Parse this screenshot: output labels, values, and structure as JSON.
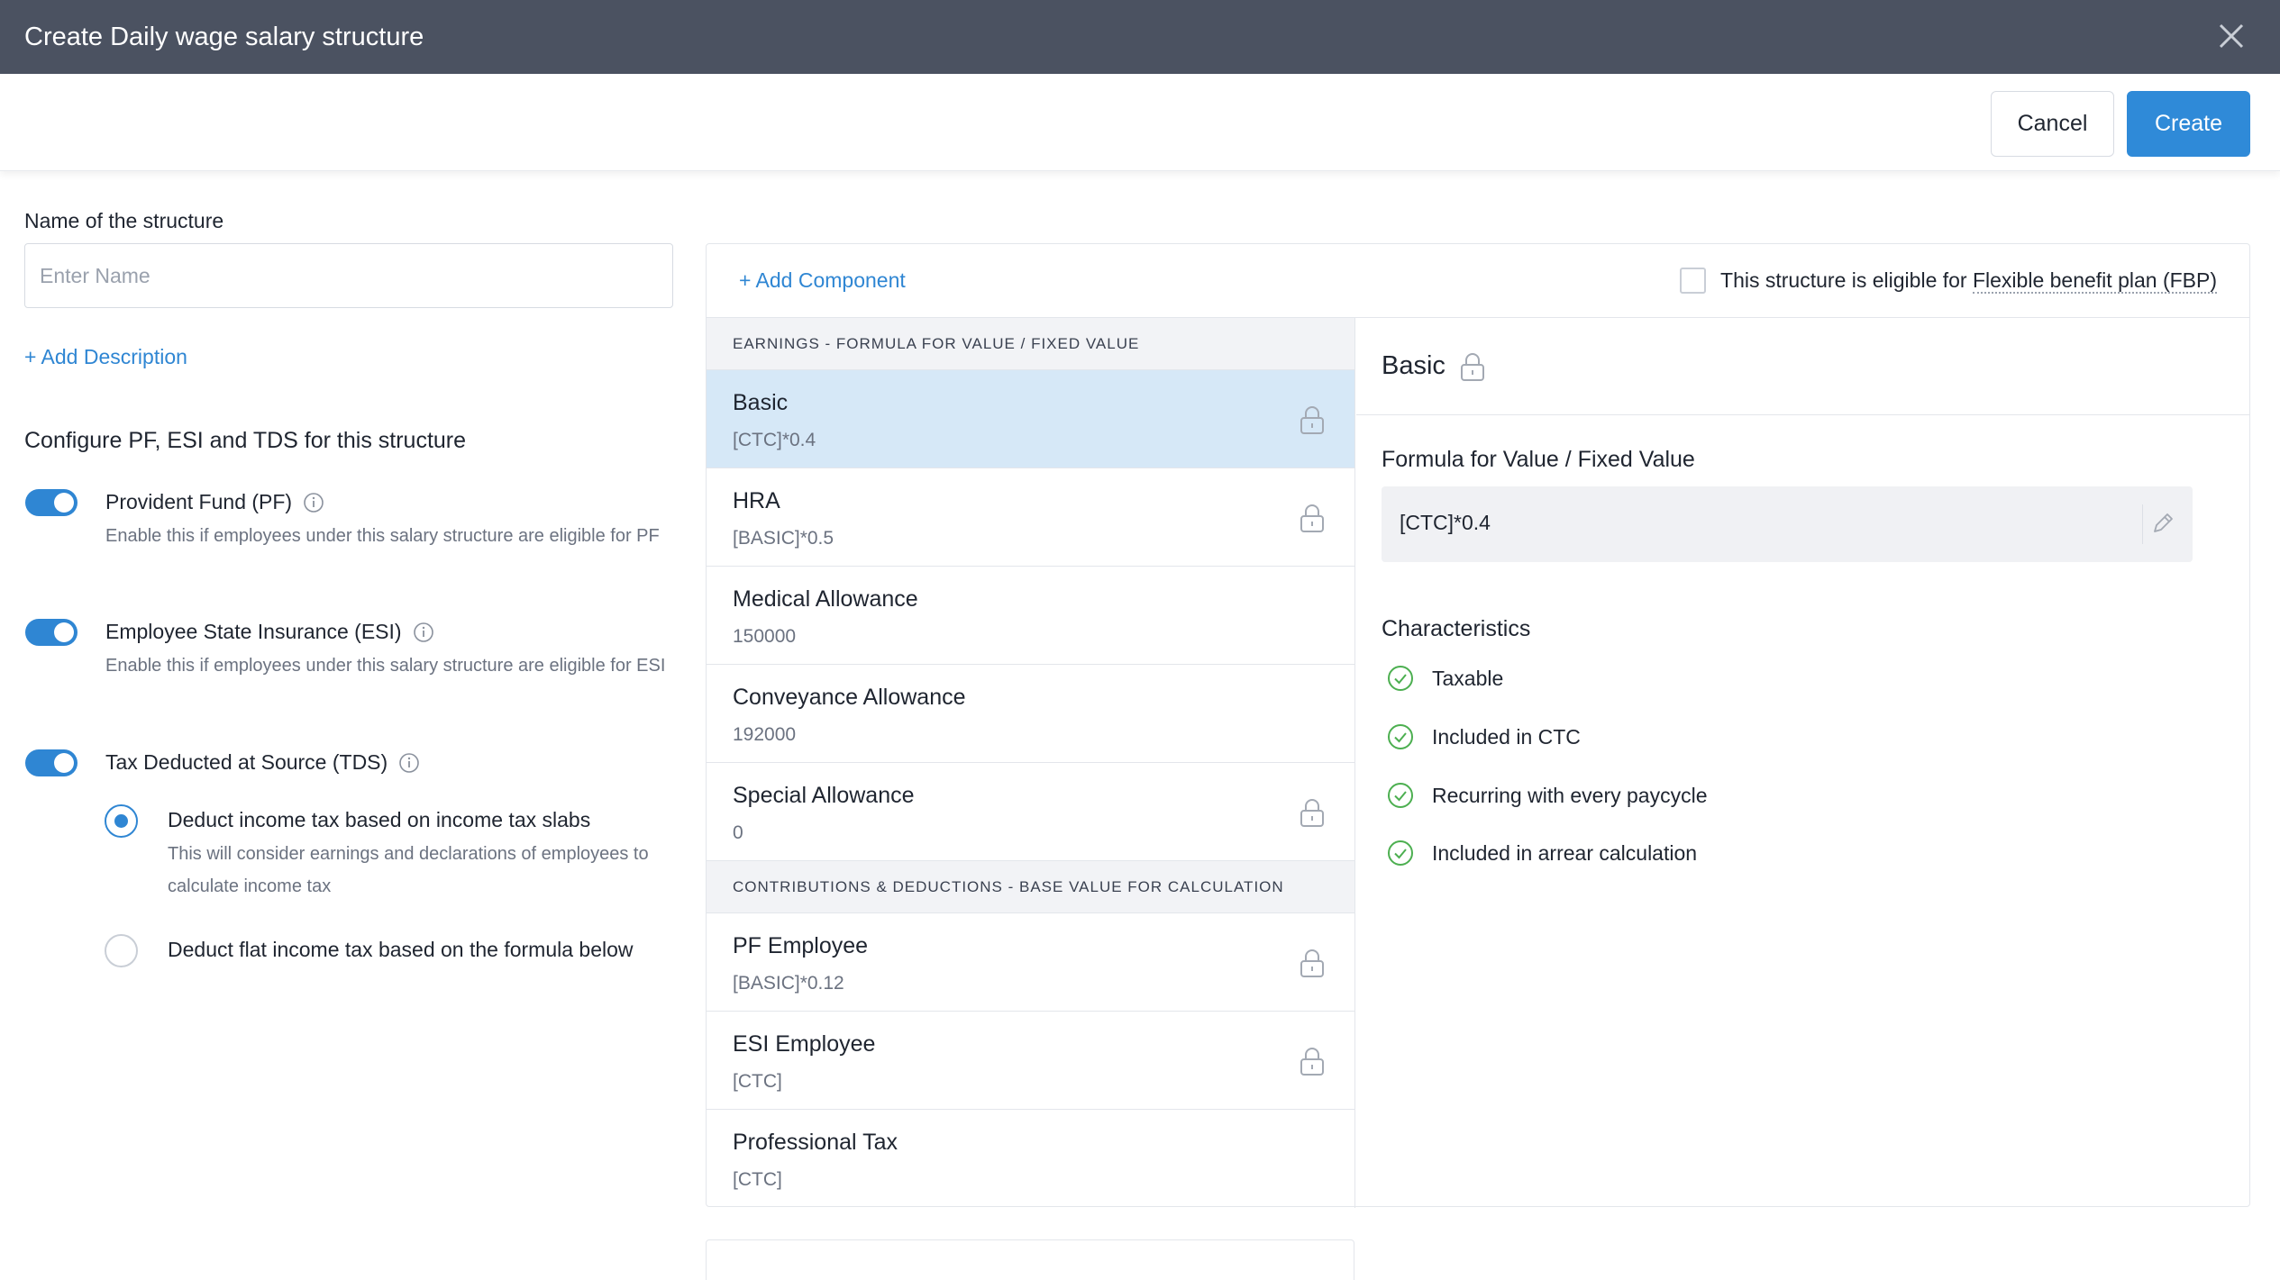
{
  "window": {
    "title": "Create Daily wage salary structure"
  },
  "actions": {
    "cancel": "Cancel",
    "create": "Create"
  },
  "form": {
    "name_label": "Name of the structure",
    "name_placeholder": "Enter Name",
    "name_value": "",
    "add_description": "+ Add Description",
    "configure_title": "Configure PF, ESI and TDS for this structure",
    "options": [
      {
        "title": "Provident Fund (PF)",
        "desc": "Enable this if employees under this salary structure are eligible for PF",
        "enabled": true
      },
      {
        "title": "Employee State Insurance (ESI)",
        "desc": "Enable this if employees under this salary structure are eligible for ESI",
        "enabled": true
      },
      {
        "title": "Tax Deducted at Source (TDS)",
        "enabled": true
      }
    ],
    "tds_modes": [
      {
        "title": "Deduct income tax based on income tax slabs",
        "desc": "This will consider earnings and declarations of employees to calculate income tax",
        "selected": true
      },
      {
        "title": "Deduct flat income tax based on the formula below",
        "selected": false
      }
    ]
  },
  "components": {
    "add_component": "+ Add Component",
    "fbp_label_prefix": "This structure is eligible for ",
    "fbp_label_link": "Flexible benefit plan (FBP)",
    "fbp_checked": false,
    "earnings_header": "EARNINGS - FORMULA FOR VALUE / FIXED VALUE",
    "earnings": [
      {
        "name": "Basic",
        "value": "[CTC]*0.4",
        "locked": true,
        "selected": true
      },
      {
        "name": "HRA",
        "value": "[BASIC]*0.5",
        "locked": true
      },
      {
        "name": "Medical Allowance",
        "value": "150000",
        "locked": false
      },
      {
        "name": "Conveyance Allowance",
        "value": "192000",
        "locked": false
      },
      {
        "name": "Special Allowance",
        "value": "0",
        "locked": true
      }
    ],
    "deductions_header": "CONTRIBUTIONS & DEDUCTIONS - BASE VALUE FOR CALCULATION",
    "deductions": [
      {
        "name": "PF Employee",
        "value": "[BASIC]*0.12",
        "locked": true
      },
      {
        "name": "ESI Employee",
        "value": "[CTC]",
        "locked": true
      },
      {
        "name": "Professional Tax",
        "value": "[CTC]",
        "locked": false
      }
    ]
  },
  "detail": {
    "name": "Basic",
    "formula_label": "Formula for Value / Fixed Value",
    "formula_value": "[CTC]*0.4",
    "characteristics_label": "Characteristics",
    "characteristics": [
      "Taxable",
      "Included in CTC",
      "Recurring with every paycycle",
      "Included in arrear calculation"
    ]
  },
  "colors": {
    "accent": "#2f86d3",
    "titlebar": "#4b5261",
    "selected_row": "#d6e8f7",
    "check_green": "#4caf50"
  },
  "icons": {
    "close": "close-icon",
    "info": "info-icon",
    "lock": "lock-icon",
    "edit": "pencil-icon",
    "check": "check-circle-icon"
  }
}
